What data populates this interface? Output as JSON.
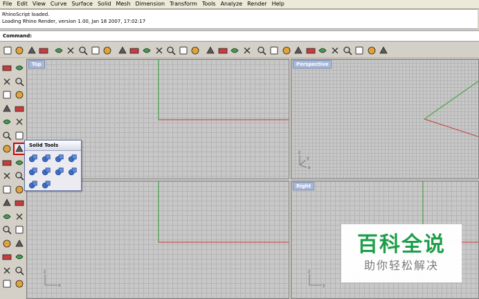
{
  "menubar": [
    "File",
    "Edit",
    "View",
    "Curve",
    "Surface",
    "Solid",
    "Mesh",
    "Dimension",
    "Transform",
    "Tools",
    "Analyze",
    "Render",
    "Help"
  ],
  "history": [
    "RhinoScript loaded.",
    "Loading Rhino Render, version 1.00, Jan 18 2007, 17:02:17"
  ],
  "command": {
    "label": "Command:",
    "value": ""
  },
  "toolbar_icons": [
    "new-icon",
    "open-icon",
    "save-icon",
    "print-icon",
    "import-icon",
    "cut-icon",
    "copy-icon",
    "paste-icon",
    "undo-icon",
    "pan-icon",
    "rotate-view-icon",
    "zoom-window-icon",
    "zoom-dynamic-icon",
    "zoom-extents-icon",
    "zoom-selected-icon",
    "undo-view-icon",
    "four-viewports-icon",
    "car-icon",
    "render-icon",
    "points-icon",
    "select-icon",
    "light-icon",
    "lock-icon",
    "shade-icon",
    "render-preview-icon",
    "ghost-icon",
    "render-sphere-icon",
    "material-icon",
    "options-icon",
    "osnap-icon",
    "help-icon"
  ],
  "viewports": {
    "top": {
      "title": "Top"
    },
    "perspective": {
      "title": "Perspective"
    },
    "front": {
      "title": ""
    },
    "right": {
      "title": "Right"
    }
  },
  "popup": {
    "title": "Solid Tools",
    "buttons": [
      "boolean-union-icon",
      "boolean-difference-icon",
      "boolean-intersection-icon",
      "boolean-split-icon",
      "extract-surface-icon",
      "cap-holes-icon",
      "merge-faces-icon",
      "shell-icon",
      "fillet-edges-icon",
      "solid-edit-icon"
    ]
  },
  "watermark": {
    "title": "百科全说",
    "subtitle": "助你轻松解决"
  },
  "colors": {
    "x_axis": "#c83232",
    "y_axis": "#32a032",
    "highlight": "#d00000"
  }
}
